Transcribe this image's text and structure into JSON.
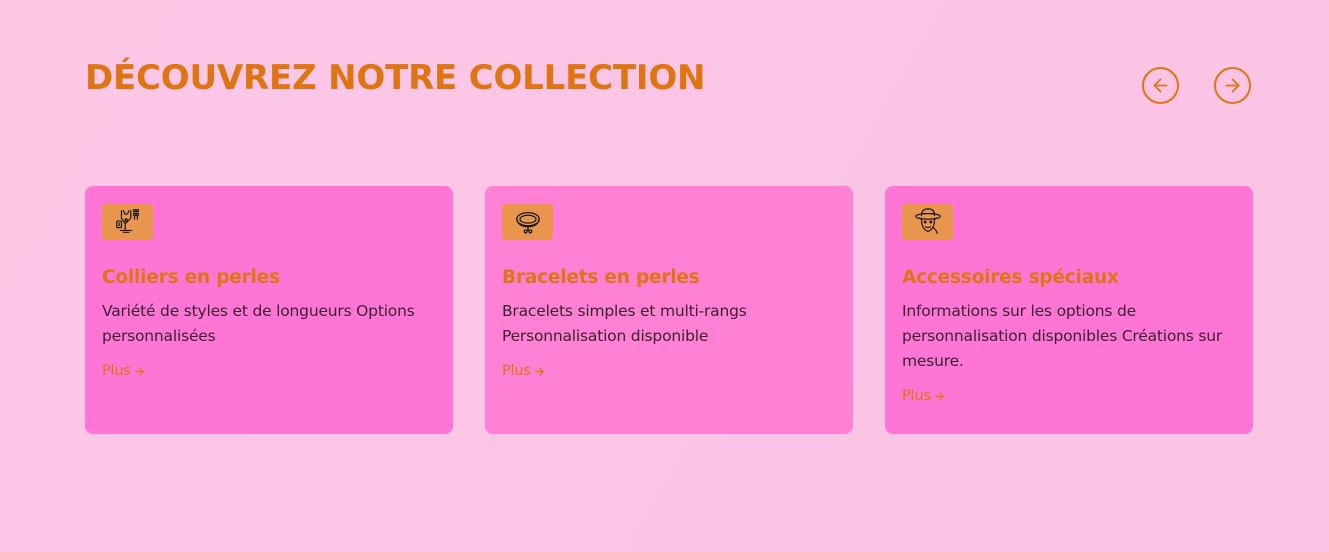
{
  "section": {
    "title": "DÉCOUVREZ NOTRE COLLECTION"
  },
  "carousel": {
    "prev_icon": "arrow-left-circle-icon",
    "next_icon": "arrow-right-circle-icon"
  },
  "colors": {
    "accent": "#df7512",
    "card_bg": "#ff75d6",
    "icon_bg": "#e8964d",
    "page_bg": "#fbc6e6"
  },
  "cards": [
    {
      "icon": "necklace-display-icon",
      "title": "Colliers en perles",
      "description": "Variété de styles et de longueurs Options personnalisées",
      "link_label": "Plus"
    },
    {
      "icon": "bracelet-icon",
      "title": "Bracelets en perles",
      "description": "Bracelets simples et multi-rangs Personnalisation disponible",
      "link_label": "Plus"
    },
    {
      "icon": "hat-person-icon",
      "title": "Accessoires spéciaux",
      "description": "Informations sur les options de personnalisation disponibles Créations sur mesure.",
      "link_label": "Plus"
    }
  ]
}
